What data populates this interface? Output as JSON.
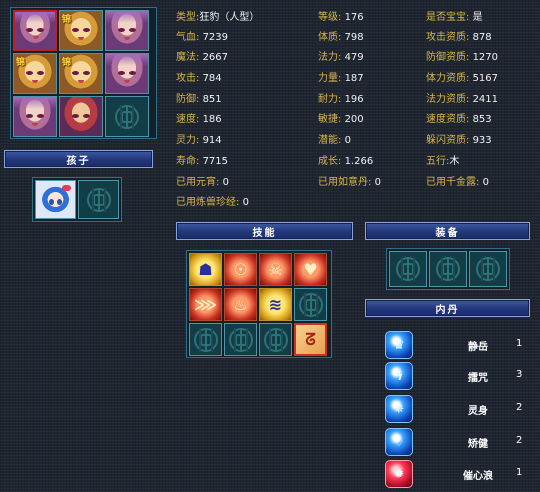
{
  "pets": {
    "badge_text": "锦"
  },
  "children": {
    "title": "孩子"
  },
  "stats": {
    "type": {
      "label": "类型:",
      "value": "狂豹（人型）"
    },
    "level": {
      "label": "等级:",
      "value": "176"
    },
    "baby": {
      "label": "是否宝宝:",
      "value": "是"
    },
    "hp": {
      "label": "气血:",
      "value": "7239"
    },
    "constitution": {
      "label": "体质:",
      "value": "798"
    },
    "atk_aptitude": {
      "label": "攻击资质:",
      "value": "878"
    },
    "mp": {
      "label": "魔法:",
      "value": "2667"
    },
    "magic": {
      "label": "法力:",
      "value": "479"
    },
    "def_aptitude": {
      "label": "防御资质:",
      "value": "1270"
    },
    "attack": {
      "label": "攻击:",
      "value": "784"
    },
    "strength": {
      "label": "力量:",
      "value": "187"
    },
    "hp_aptitude": {
      "label": "体力资质:",
      "value": "5167"
    },
    "defense": {
      "label": "防御:",
      "value": "851"
    },
    "endurance": {
      "label": "耐力:",
      "value": "196"
    },
    "magic_aptitude": {
      "label": "法力资质:",
      "value": "2411"
    },
    "speed": {
      "label": "速度:",
      "value": "186"
    },
    "agility": {
      "label": "敏捷:",
      "value": "200"
    },
    "speed_aptitude": {
      "label": "速度资质:",
      "value": "853"
    },
    "spirit": {
      "label": "灵力:",
      "value": "914"
    },
    "potential": {
      "label": "潜能:",
      "value": "0"
    },
    "dodge_aptitude": {
      "label": "躲闪资质:",
      "value": "933"
    },
    "lifespan": {
      "label": "寿命:",
      "value": "7715"
    },
    "growth": {
      "label": "成长:",
      "value": "1.266"
    },
    "element": {
      "label": "五行:",
      "value": "木"
    },
    "yuanxiao": {
      "label": "已用元宵:",
      "value": "0"
    },
    "ruyidan": {
      "label": "已用如意丹:",
      "value": "0"
    },
    "qianjinlu": {
      "label": "已用千金露:",
      "value": "0"
    },
    "lianshou": {
      "label": "已用炼兽珍经:",
      "value": "0"
    }
  },
  "skills": {
    "title": "技能",
    "icons": [
      {
        "name": "skill-silhouette-icon",
        "glyph": "☗",
        "style": "gold"
      },
      {
        "name": "skill-owl-icon",
        "glyph": "☉",
        "style": "red"
      },
      {
        "name": "skill-skull-icon",
        "glyph": "☠",
        "style": "red"
      },
      {
        "name": "skill-heart-icon",
        "glyph": "♥",
        "style": "red"
      },
      {
        "name": "skill-claw-icon",
        "glyph": "⋙",
        "style": "red"
      },
      {
        "name": "skill-fire-icon",
        "glyph": "♨",
        "style": "red"
      },
      {
        "name": "skill-wave-icon",
        "glyph": "≋",
        "style": "gold"
      },
      {
        "name": "skill-empty-slot",
        "glyph": "",
        "style": "empty"
      },
      {
        "name": "skill-empty-slot",
        "glyph": "",
        "style": "empty"
      },
      {
        "name": "skill-empty-slot",
        "glyph": "",
        "style": "empty"
      },
      {
        "name": "skill-empty-slot",
        "glyph": "",
        "style": "empty"
      },
      {
        "name": "skill-swirl-icon",
        "glyph": "ᘔ",
        "style": "peach"
      }
    ]
  },
  "equipment": {
    "title": "装备"
  },
  "inner": {
    "title": "内丹",
    "items": [
      {
        "name": "静岳",
        "level": "1",
        "icon": "inner-mountain-icon",
        "glyph": "♛",
        "color": "blue"
      },
      {
        "name": "擂咒",
        "level": "3",
        "icon": "inner-lightning-icon",
        "glyph": "ϟ",
        "color": "blue"
      },
      {
        "name": "灵身",
        "level": "2",
        "icon": "inner-spirit-icon",
        "glyph": "✵",
        "color": "blue"
      },
      {
        "name": "矫健",
        "level": "2",
        "icon": "inner-agility-icon",
        "glyph": "♢",
        "color": "blue"
      },
      {
        "name": "催心浪",
        "level": "1",
        "icon": "inner-wave-icon",
        "glyph": "✹",
        "color": "red"
      }
    ]
  }
}
